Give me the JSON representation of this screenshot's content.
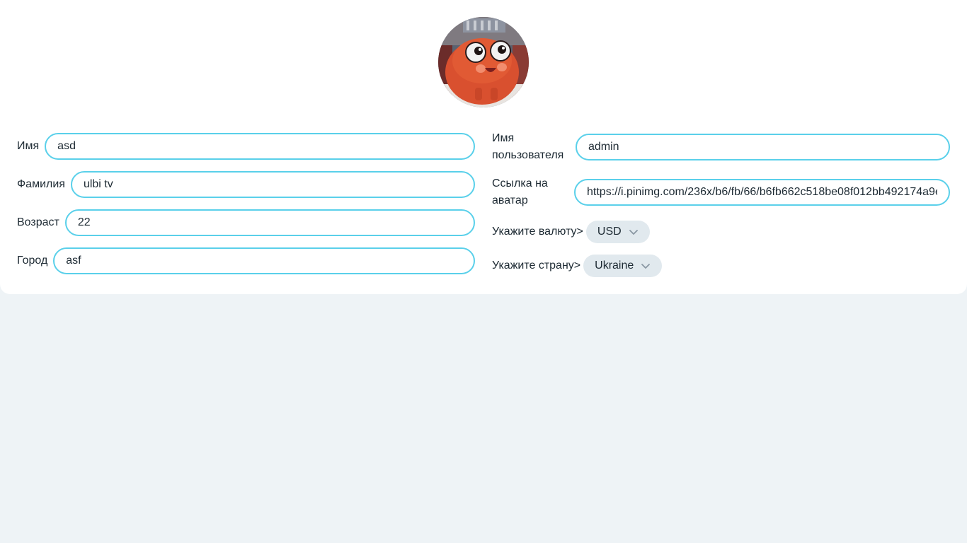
{
  "profile": {
    "avatar_alt": "avatar",
    "fields": {
      "first": {
        "label": "Имя",
        "value": "asd"
      },
      "last": {
        "label": "Фамилия",
        "value": "ulbi tv"
      },
      "age": {
        "label": "Возраст",
        "value": "22"
      },
      "city": {
        "label": "Город",
        "value": "asf"
      },
      "username": {
        "label": "Имя пользователя",
        "value": "admin"
      },
      "avatar_link": {
        "label": "Ссылка на аватар",
        "value": "https://i.pinimg.com/236x/b6/fb/66/b6fb662c518be08f012bb492174a9e"
      }
    },
    "currency": {
      "label": "Укажите валюту>",
      "selected": "USD"
    },
    "country": {
      "label": "Укажите страну>",
      "selected": "Ukraine"
    }
  },
  "icons": {
    "chevron": "chevron-down-icon",
    "avatar": "character-avatar"
  },
  "colors": {
    "input_border": "#5ad0ea",
    "page_bg": "#eef3f6",
    "select_bg": "#e1e9ee"
  }
}
